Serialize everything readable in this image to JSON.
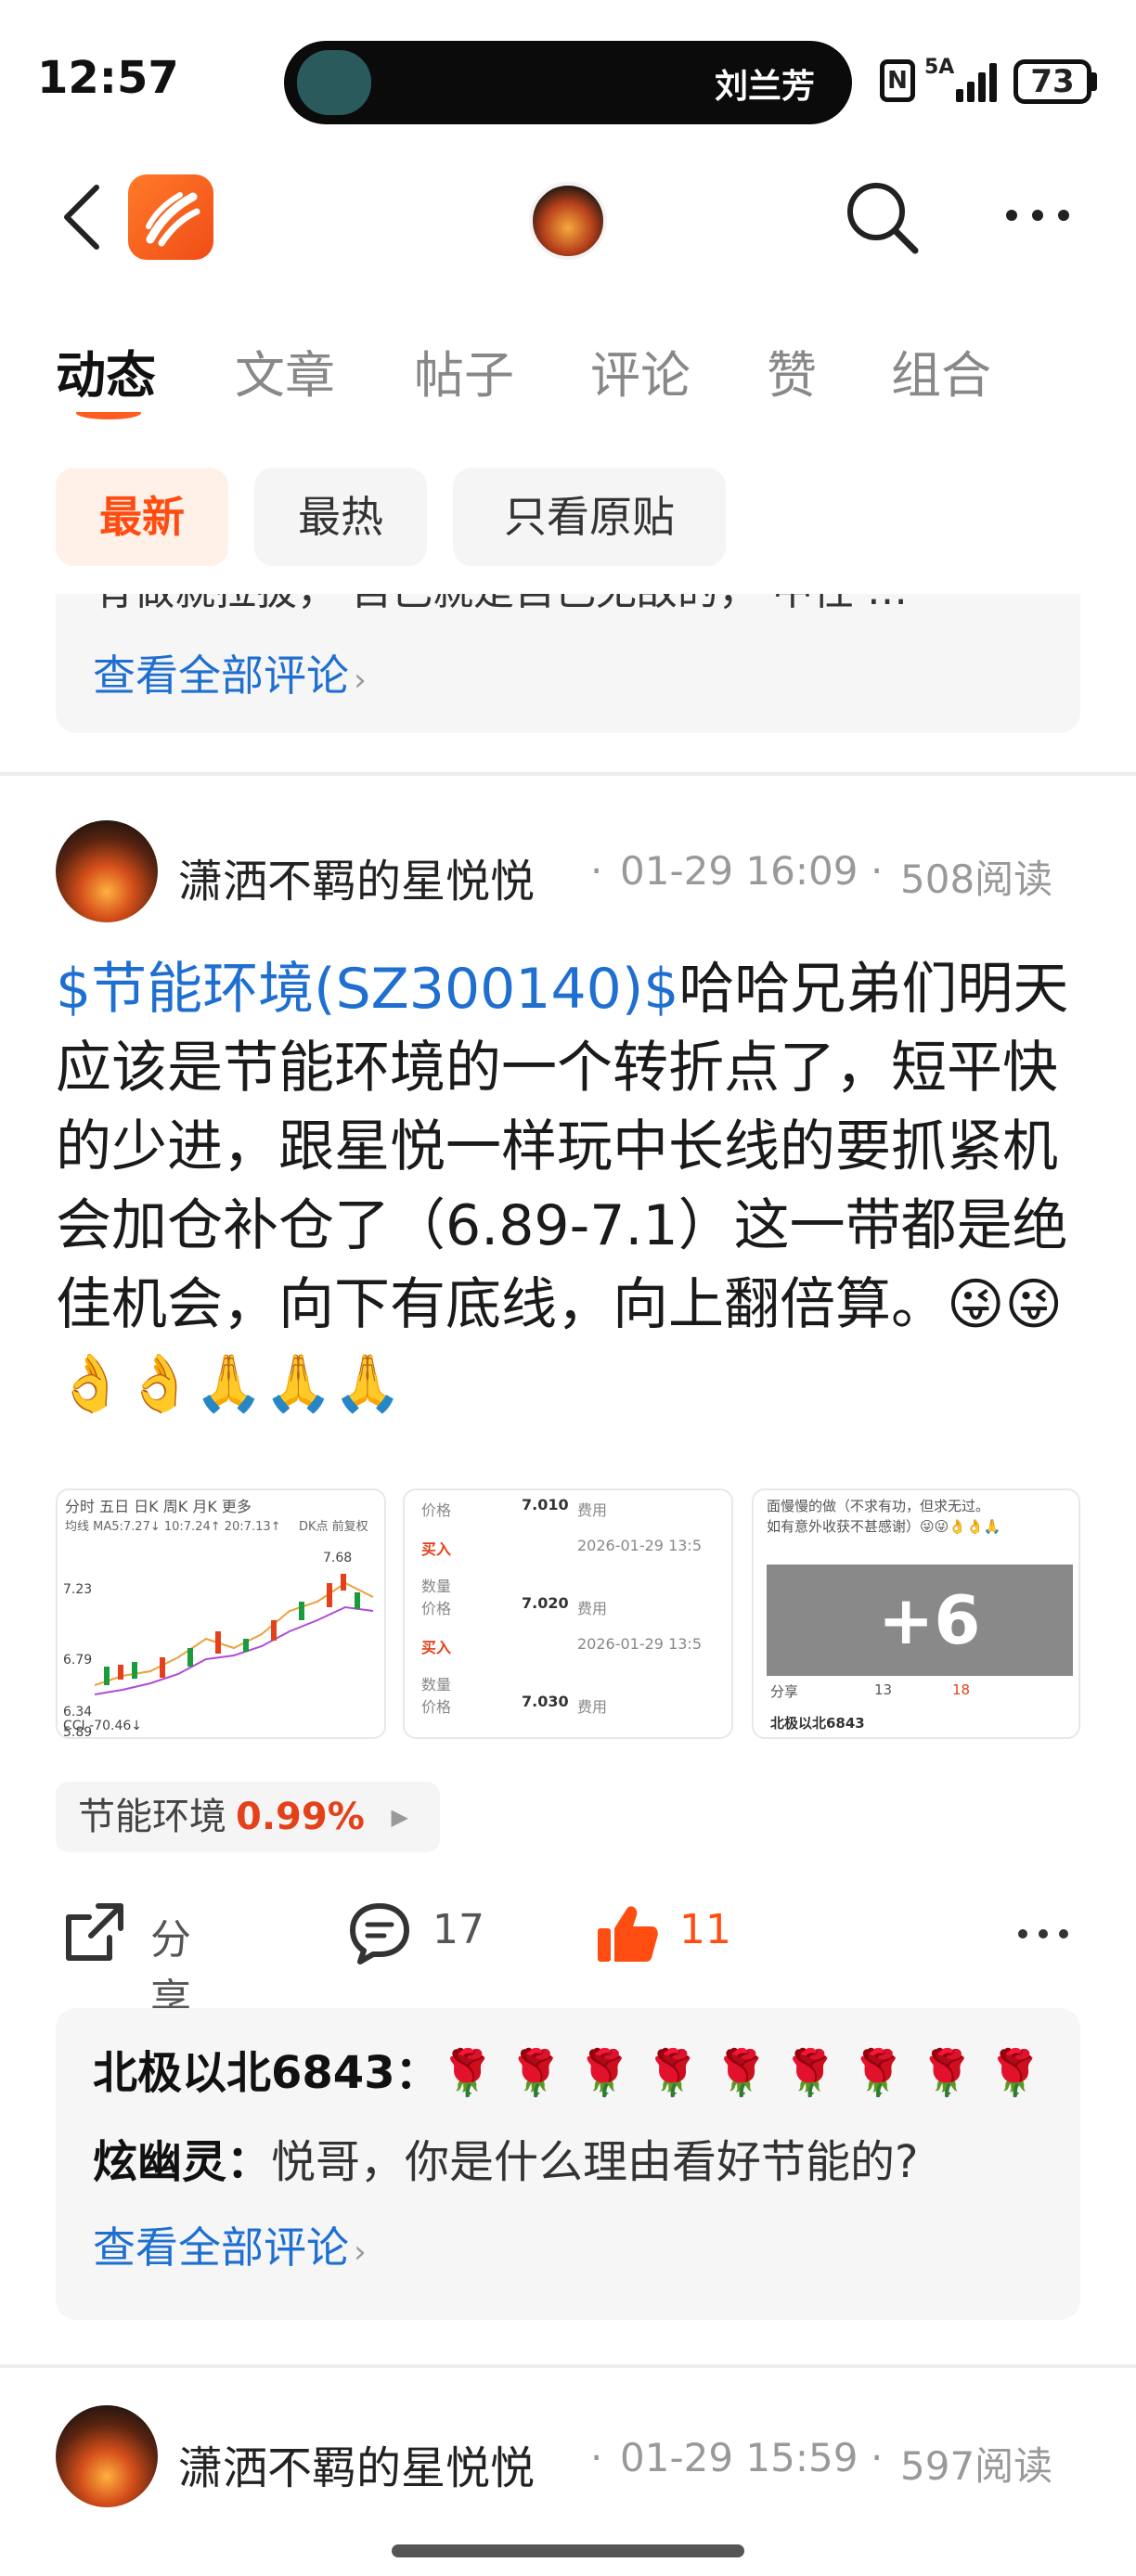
{
  "status_bar": {
    "time": "12:57",
    "island_name": "刘兰芳",
    "network": "5A",
    "nfc": "N",
    "battery": "73"
  },
  "tabs": [
    {
      "label": "动态"
    },
    {
      "label": "文章"
    },
    {
      "label": "帖子"
    },
    {
      "label": "评论"
    },
    {
      "label": "赞"
    },
    {
      "label": "组合"
    }
  ],
  "filters": [
    {
      "label": "最新"
    },
    {
      "label": "最热"
    },
    {
      "label": "只看原贴"
    }
  ],
  "prev_card": {
    "clipped_text": "有做就拉拔，  自己就是自己无敌的，  中性 …",
    "view_all": "查看全部评论"
  },
  "post": {
    "author": "潇洒不羁的星悦悦",
    "date": "01-29 16:09",
    "reads": "508阅读",
    "ticker": "$节能环境(SZ300140)$",
    "body": "哈哈兄弟们明天应该是节能环境的一个转折点了，短平快的少进，跟星悦一样玩中长线的要抓紧机会加仓补仓了（6.89-7.1）这一带都是绝佳机会，向下有底线，向上翻倍算。😜😜👌👌🙏🙏🙏",
    "images": {
      "chart": {
        "tabs": "分时  五日  日K  周K  月K  更多",
        "ma": "均线  MA5:7.27↓ 10:7.24↑ 20:7.13↑",
        "dk": "DK点  前复权",
        "prices": [
          "7.68",
          "7.23",
          "6.79",
          "6.34",
          "5.89"
        ],
        "cci": "CCI -70.46↓"
      },
      "order": {
        "rows": [
          {
            "price": "7.010",
            "time": "2026-01-29 13:5"
          },
          {
            "price": "7.020",
            "time": "2026-01-29 13:5"
          },
          {
            "price": "7.030",
            "time": ""
          }
        ],
        "label_price": "价格",
        "label_fee": "费用",
        "label_buy": "买入",
        "label_qty": "数量"
      },
      "screenshot": {
        "text1": "面慢慢的做（不求有功，但求无过。",
        "text2": "如有意外收获不甚感谢）😜😜👌👌🙏",
        "share": "分享",
        "comments": "13",
        "likes": "18",
        "name": "北极以北6843",
        "more": "+6"
      }
    },
    "stock_tag": {
      "name": "节能环境",
      "change": "0.99%"
    },
    "actions": {
      "share": "分享",
      "comments": "17",
      "likes": "11"
    },
    "comments": [
      {
        "user": "北极以北6843：",
        "text": "🌹🌹🌹🌹🌹🌹🌹🌹🌹"
      },
      {
        "user": "炫幽灵：",
        "text": "悦哥，你是什么理由看好节能的?"
      }
    ],
    "view_all": "查看全部评论"
  },
  "next_post": {
    "author": "潇洒不羁的星悦悦",
    "date": "01-29 15:59",
    "reads": "597阅读"
  },
  "colors": {
    "accent": "#ff5a1f",
    "link": "#1f6fd1",
    "up": "#e4411b"
  }
}
